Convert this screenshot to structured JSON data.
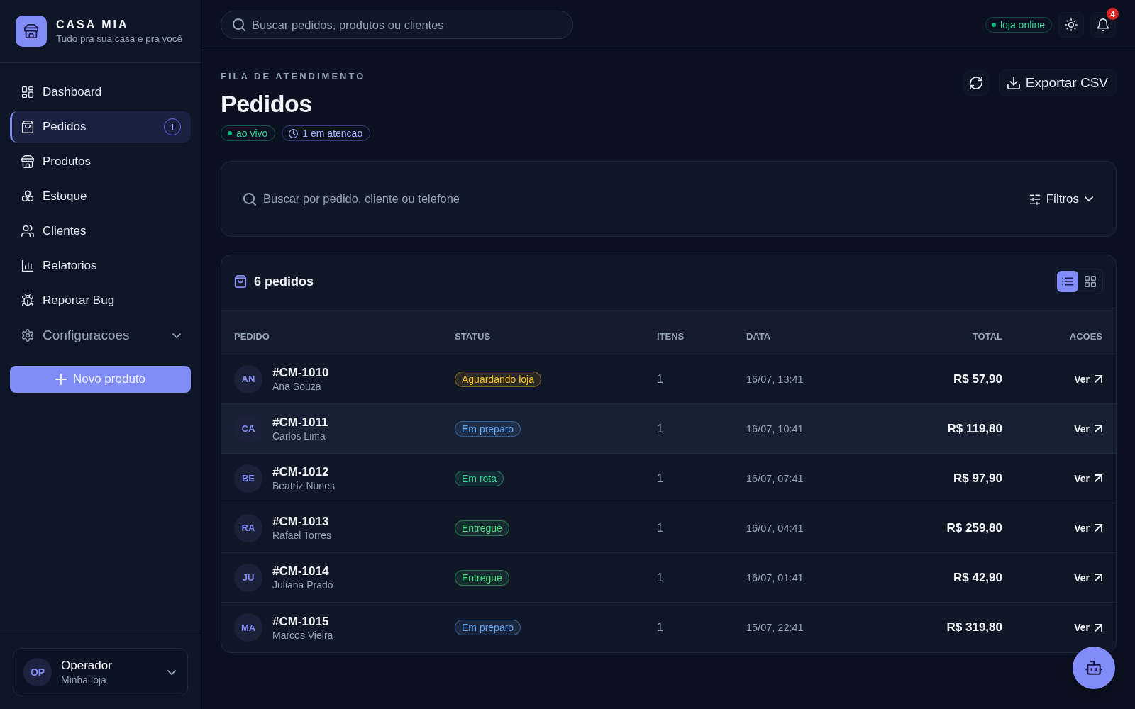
{
  "sidebar": {
    "brand": {
      "name": "CASA MIA",
      "tagline": "Tudo pra sua casa e pra você"
    },
    "nav": [
      {
        "label": "Dashboard",
        "kind": "link",
        "selected": false
      },
      {
        "label": "Pedidos",
        "kind": "link",
        "selected": true,
        "count": "1"
      },
      {
        "label": "Produtos",
        "kind": "link",
        "selected": false
      },
      {
        "label": "Estoque",
        "kind": "link",
        "selected": false
      },
      {
        "label": "Clientes",
        "kind": "link",
        "selected": false
      },
      {
        "label": "Relatorios",
        "kind": "link",
        "selected": false
      },
      {
        "label": "Reportar Bug",
        "kind": "link",
        "selected": false
      },
      {
        "label": "Configuracoes",
        "kind": "group",
        "selected": false,
        "expanded": false
      }
    ],
    "action_button": "Novo produto",
    "user": {
      "initials": "OP",
      "name": "Operador",
      "subtitle": "Minha loja"
    }
  },
  "topbar": {
    "search": {
      "placeholder": "Buscar pedidos, produtos ou clientes"
    },
    "store_status": {
      "label": "loja online",
      "online": true
    },
    "notifications": {
      "count": "4"
    }
  },
  "header": {
    "eyebrow": "FILA DE ATENDIMENTO",
    "title": "Pedidos",
    "badges": [
      {
        "kind": "live",
        "label": "ao vivo"
      },
      {
        "kind": "attention",
        "label": "1 em atencao"
      }
    ],
    "export_label": "Exportar CSV"
  },
  "filter_bar": {
    "search": {
      "placeholder": "Buscar por pedido, cliente ou telefone"
    },
    "filters_label": "Filtros"
  },
  "orders": {
    "count_label": "6 pedidos",
    "views": [
      {
        "kind": "list",
        "selected": true
      },
      {
        "kind": "grid",
        "selected": false
      }
    ],
    "columns": [
      "PEDIDO",
      "STATUS",
      "ITENS",
      "DATA",
      "TOTAL",
      "ACOES"
    ],
    "rows": [
      {
        "initials": "AN",
        "order": "#CM-1010",
        "customer": "Ana Souza",
        "status": {
          "label": "Aguardando loja",
          "color": "#fbbf24"
        },
        "items": "1",
        "date": "16/07, 13:41",
        "total": "R$ 57,90",
        "action": "Ver",
        "highlighted": false
      },
      {
        "initials": "CA",
        "order": "#CM-1011",
        "customer": "Carlos Lima",
        "status": {
          "label": "Em preparo",
          "color": "#60a5fa"
        },
        "items": "1",
        "date": "16/07, 10:41",
        "total": "R$ 119,80",
        "action": "Ver",
        "highlighted": true
      },
      {
        "initials": "BE",
        "order": "#CM-1012",
        "customer": "Beatriz Nunes",
        "status": {
          "label": "Em rota",
          "color": "#34d399"
        },
        "items": "1",
        "date": "16/07, 07:41",
        "total": "R$ 97,90",
        "action": "Ver",
        "highlighted": false
      },
      {
        "initials": "RA",
        "order": "#CM-1013",
        "customer": "Rafael Torres",
        "status": {
          "label": "Entregue",
          "color": "#4ade80"
        },
        "items": "1",
        "date": "16/07, 04:41",
        "total": "R$ 259,80",
        "action": "Ver",
        "highlighted": false
      },
      {
        "initials": "JU",
        "order": "#CM-1014",
        "customer": "Juliana Prado",
        "status": {
          "label": "Entregue",
          "color": "#4ade80"
        },
        "items": "1",
        "date": "16/07, 01:41",
        "total": "R$ 42,90",
        "action": "Ver",
        "highlighted": false
      },
      {
        "initials": "MA",
        "order": "#CM-1015",
        "customer": "Marcos Vieira",
        "status": {
          "label": "Em preparo",
          "color": "#60a5fa"
        },
        "items": "1",
        "date": "15/07, 22:41",
        "total": "R$ 319,80",
        "action": "Ver",
        "highlighted": false
      }
    ]
  }
}
